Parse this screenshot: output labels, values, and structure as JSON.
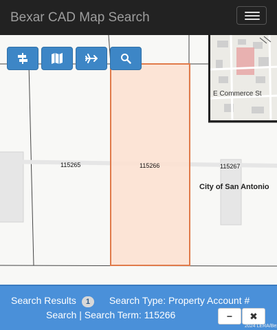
{
  "header": {
    "title": "Bexar CAD Map Search"
  },
  "toolbar": {
    "buttons": [
      {
        "icon": "road-sign-icon"
      },
      {
        "icon": "map-icon"
      },
      {
        "icon": "airplane-icon"
      },
      {
        "icon": "search-icon"
      }
    ]
  },
  "map": {
    "parcels": [
      {
        "id": "115265"
      },
      {
        "id": "115266",
        "selected": true
      },
      {
        "id": "115267"
      }
    ],
    "place_label": "City of San Antonio",
    "overview": {
      "street_label": "E Commerce St"
    }
  },
  "results": {
    "label": "Search Results",
    "count": "1",
    "type_text": "Search Type: Property Account #",
    "term_text": "Search | Search Term: 115266",
    "minimize_label": "−",
    "close_label": "✖"
  },
  "attribution": "2024 LERA/Bex",
  "colors": {
    "navbar": "#222222",
    "selected_fill": "#fde0d0",
    "selected_stroke": "#e07a4a",
    "results_panel": "#4a90d9",
    "tool_button": "#3d86c6"
  }
}
